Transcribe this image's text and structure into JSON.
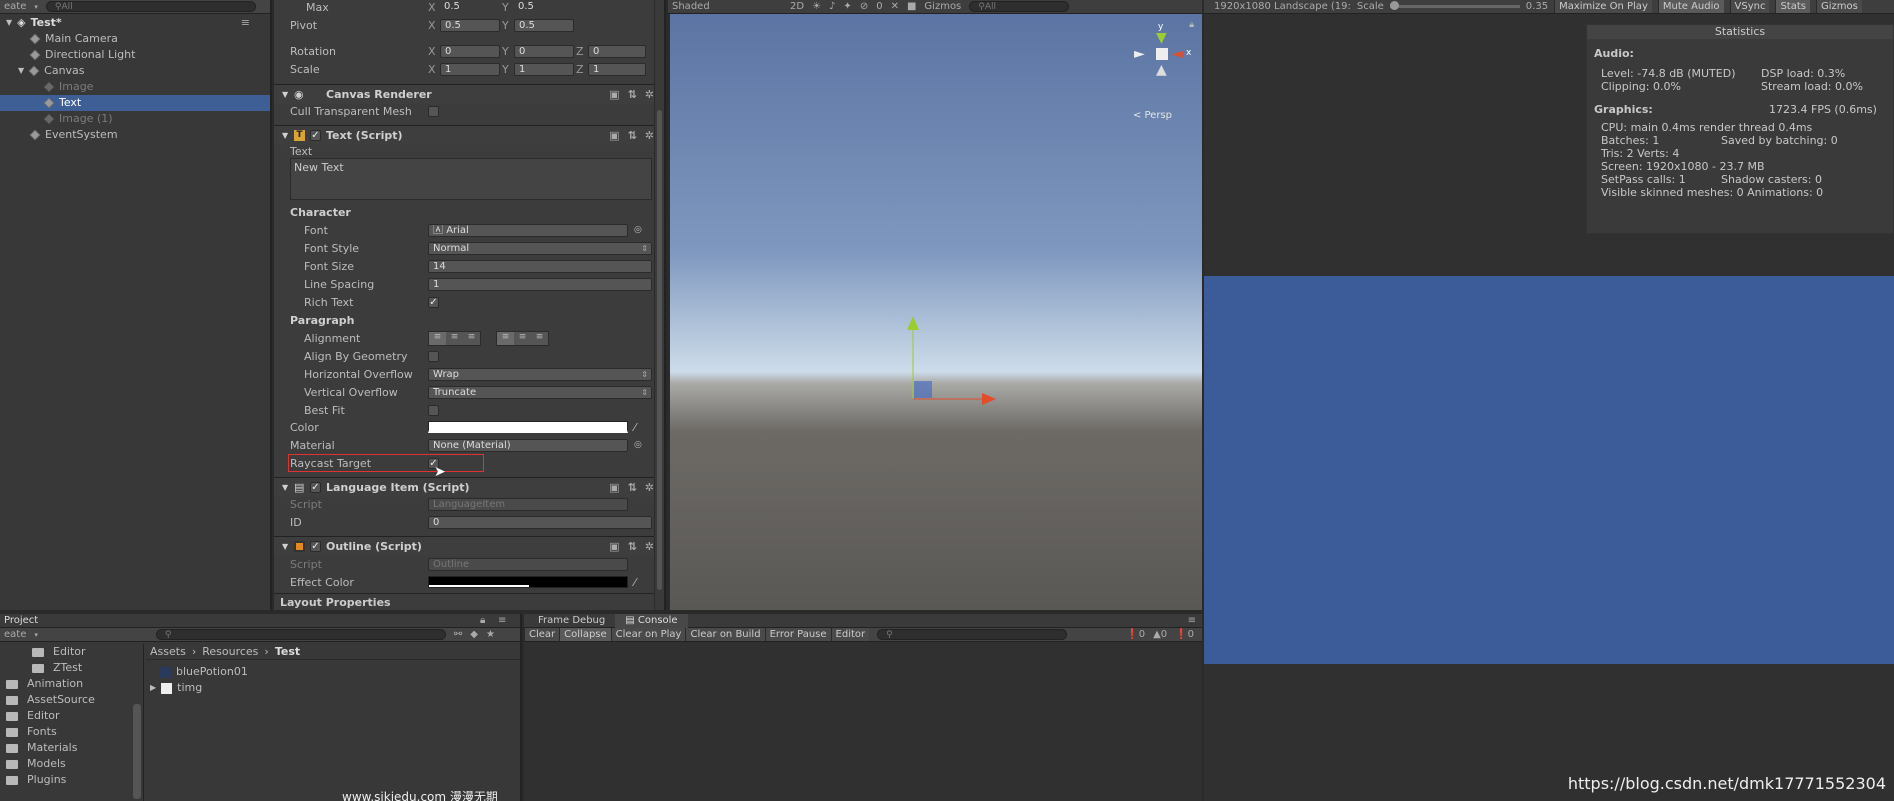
{
  "hierarchy": {
    "create_label": "eate",
    "search_placeholder": "All",
    "scene_name": "Test*",
    "items": [
      {
        "label": "Main Camera",
        "indent": 1
      },
      {
        "label": "Directional Light",
        "indent": 1
      },
      {
        "label": "Canvas",
        "indent": 1
      },
      {
        "label": "Image",
        "indent": 2
      },
      {
        "label": "Text",
        "indent": 2
      },
      {
        "label": "Image (1)",
        "indent": 2
      },
      {
        "label": "EventSystem",
        "indent": 1
      }
    ]
  },
  "inspector": {
    "max": {
      "label": "Max",
      "x": "0.5",
      "y": "0.5"
    },
    "pivot": {
      "label": "Pivot",
      "x": "0.5",
      "y": "0.5"
    },
    "rotation": {
      "label": "Rotation",
      "x": "0",
      "y": "0",
      "z": "0"
    },
    "scale": {
      "label": "Scale",
      "x": "1",
      "y": "1",
      "z": "1"
    },
    "axis": {
      "x": "X",
      "y": "Y",
      "z": "Z"
    },
    "canvas_renderer": {
      "title": "Canvas Renderer",
      "cull_label": "Cull Transparent Mesh"
    },
    "text_script": {
      "title": "Text (Script)",
      "text_label": "Text",
      "text_value": "New Text",
      "character": "Character",
      "font_label": "Font",
      "font_value": "Arial",
      "font_style_label": "Font Style",
      "font_style_value": "Normal",
      "font_size_label": "Font Size",
      "font_size_value": "14",
      "line_spacing_label": "Line Spacing",
      "line_spacing_value": "1",
      "rich_text_label": "Rich Text",
      "paragraph": "Paragraph",
      "alignment_label": "Alignment",
      "align_by_geometry_label": "Align By Geometry",
      "h_overflow_label": "Horizontal Overflow",
      "h_overflow_value": "Wrap",
      "v_overflow_label": "Vertical Overflow",
      "v_overflow_value": "Truncate",
      "best_fit_label": "Best Fit",
      "color_label": "Color",
      "material_label": "Material",
      "material_value": "None (Material)",
      "raycast_label": "Raycast Target"
    },
    "language_item": {
      "title": "Language Item (Script)",
      "script_label": "Script",
      "script_value": "LanguageItem",
      "id_label": "ID",
      "id_value": "0"
    },
    "outline": {
      "title": "Outline (Script)",
      "script_label": "Script",
      "script_value": "Outline",
      "effect_color_label": "Effect Color"
    },
    "layout_properties": "Layout Properties"
  },
  "scene": {
    "shading": "Shaded",
    "mode_2d": "2D",
    "gizmos": "Gizmos",
    "search": "All",
    "fx_count": "0",
    "persp": "Persp",
    "gizmo_y": "y",
    "gizmo_x": "x"
  },
  "game": {
    "resolution": "1920x1080 Landscape (19:",
    "scale_label": "Scale",
    "scale_value": "0.35",
    "maximize": "Maximize On Play",
    "mute": "Mute Audio",
    "vsync": "VSync",
    "stats": "Stats",
    "gizmos": "Gizmos",
    "statistics_title": "Statistics",
    "audio_heading": "Audio:",
    "audio_level": "Level: -74.8 dB (MUTED)",
    "dsp_load": "DSP load: 0.3%",
    "clipping": "Clipping: 0.0%",
    "stream_load": "Stream load: 0.0%",
    "graphics_heading": "Graphics:",
    "fps": "1723.4 FPS (0.6ms)",
    "cpu": "CPU: main 0.4ms  render thread 0.4ms",
    "batches": "Batches: 1",
    "saved_batching": "Saved by batching: 0",
    "tris": "Tris: 2   Verts: 4",
    "screen": "Screen: 1920x1080 - 23.7 MB",
    "setpass": "SetPass calls: 1",
    "shadow_casters": "Shadow casters: 0",
    "skinned": "Visible skinned meshes: 0  Animations: 0",
    "watermark": "https://blog.csdn.net/dmk17771552304",
    "game_color": "#3b5b99"
  },
  "project": {
    "tab": "Project",
    "create_label": "eate",
    "breadcrumb": [
      "Assets",
      "Resources",
      "Test"
    ],
    "tree": [
      "Editor",
      "ZTest",
      "Animation",
      "AssetSource",
      "Editor",
      "Fonts",
      "Materials",
      "Models",
      "Plugins"
    ],
    "assets": [
      "bluePotion01",
      "timg"
    ],
    "footer_watermark": "www.sikiedu.com 漫漫无期"
  },
  "console": {
    "tab_frame_debug": "Frame Debug",
    "tab_console": "Console",
    "buttons": [
      "Clear",
      "Collapse",
      "Clear on Play",
      "Clear on Build",
      "Error Pause",
      "Editor"
    ],
    "count_log": "0",
    "count_warn": "0",
    "count_error": "0"
  }
}
